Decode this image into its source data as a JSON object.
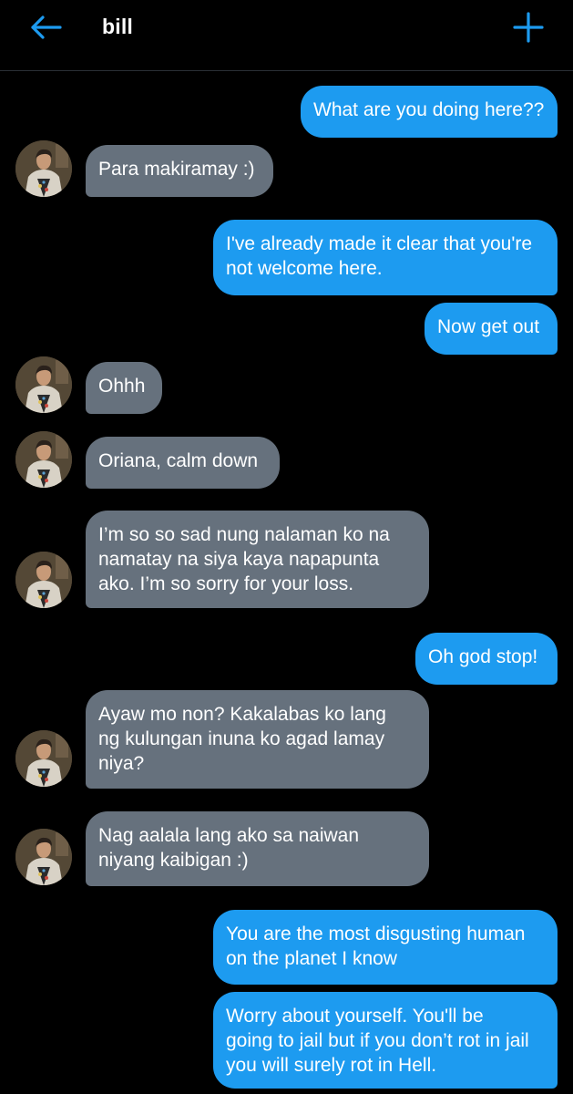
{
  "header": {
    "title": "bill",
    "accent": "#1d9bf0",
    "back_icon": "arrow-left-icon",
    "compose_icon": "plus-icon"
  },
  "colors": {
    "sent_bubble": "#1d9bf0",
    "received_bubble": "#66717d",
    "background": "#000000"
  },
  "messages": [
    {
      "from": "me",
      "text": "What are you doing here??"
    },
    {
      "from": "bill",
      "text": "Para makiramay :)"
    },
    {
      "from": "me",
      "text": "I've already made it clear that you're\nnot welcome here."
    },
    {
      "from": "me",
      "text": "Now get out"
    },
    {
      "from": "bill",
      "text": "Ohhh"
    },
    {
      "from": "bill",
      "text": "Oriana, calm down"
    },
    {
      "from": "bill",
      "text": "I’m so so sad nung nalaman ko na\nnamatay na siya kaya napapunta\nako. I’m so sorry for your loss."
    },
    {
      "from": "me",
      "text": "Oh god stop!"
    },
    {
      "from": "bill",
      "text": "Ayaw mo non? Kakalabas ko lang\nng kulungan inuna ko agad lamay\nniya?"
    },
    {
      "from": "bill",
      "text": "Nag aalala lang ako sa naiwan\nniyang kaibigan :)"
    },
    {
      "from": "me",
      "text": "You are the most disgusting human\non the planet I know"
    },
    {
      "from": "me",
      "text": "Worry about yourself. You'll be\ngoing to jail but if you don’t rot in jail\nyou will surely rot in Hell."
    }
  ]
}
